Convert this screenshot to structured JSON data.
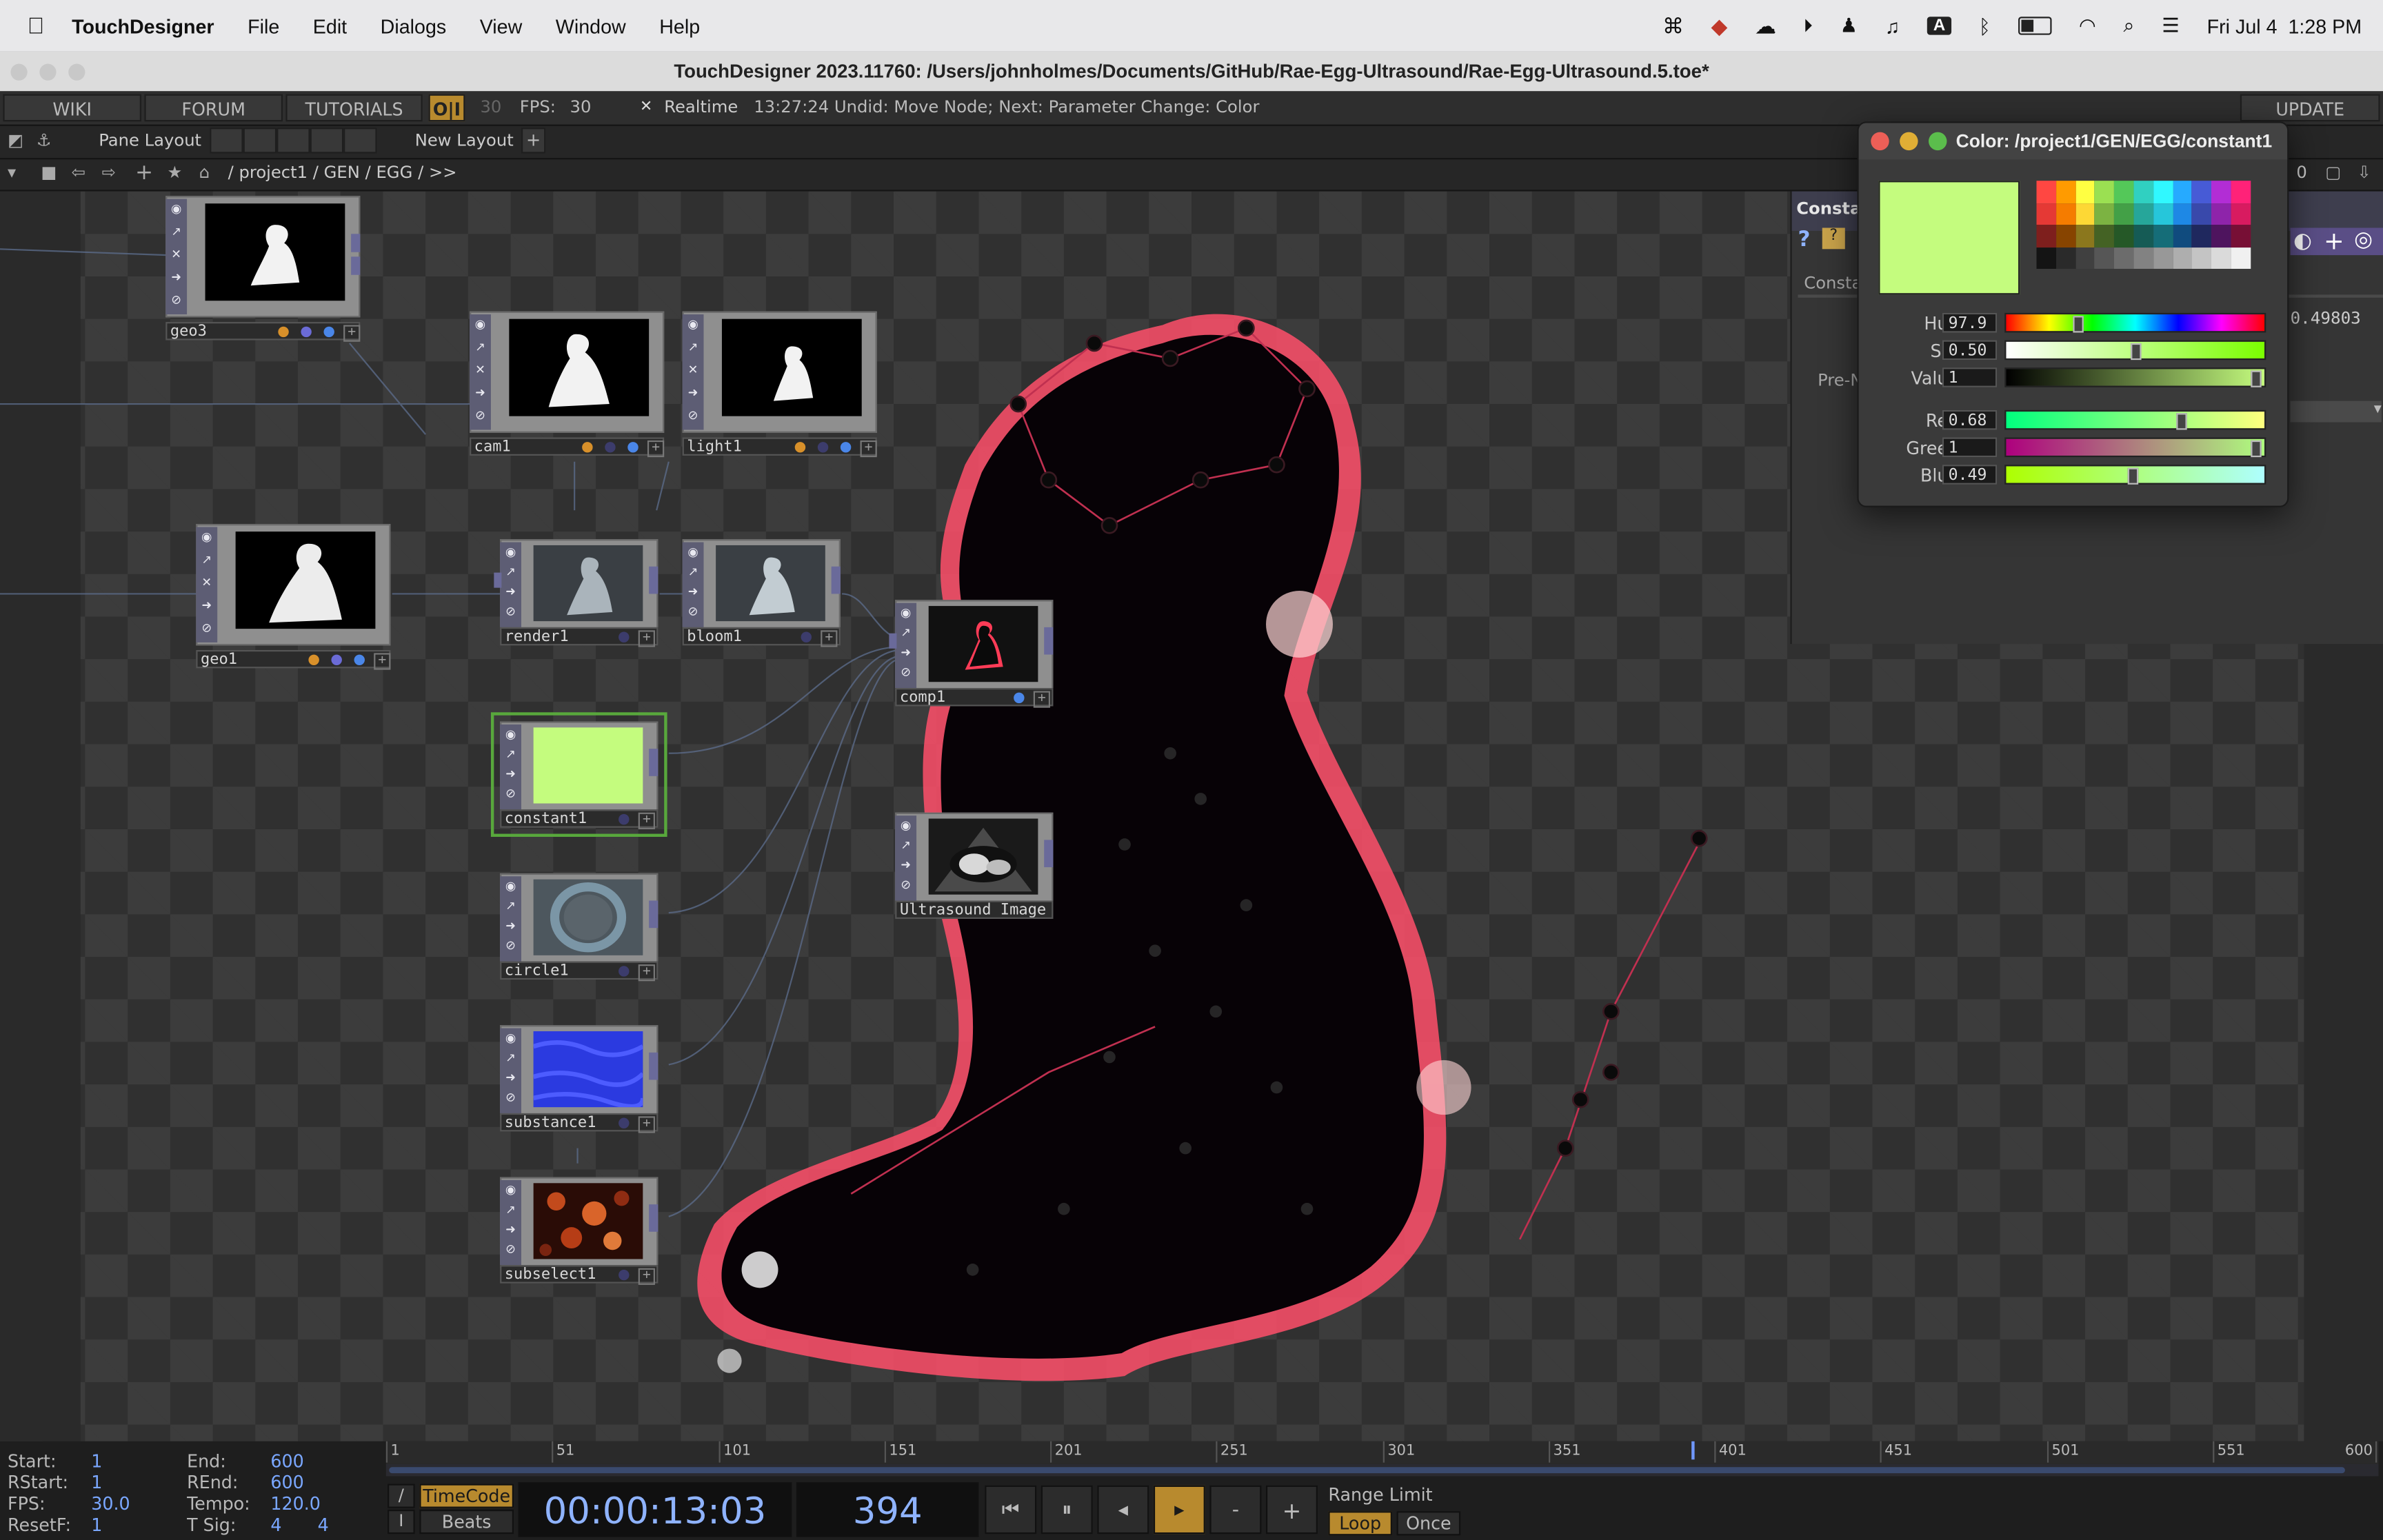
{
  "menubar": {
    "app": "TouchDesigner",
    "items": [
      "File",
      "Edit",
      "Dialogs",
      "View",
      "Window",
      "Help"
    ],
    "clock": "Fri Jul 4  1:28 PM",
    "status_icons": [
      "openai-icon",
      "dropbox-icon",
      "cloud-icon",
      "play-icon",
      "accessibility-icon",
      "headphones-icon",
      "input-a-icon",
      "bluetooth-icon",
      "battery-icon",
      "wifi-icon",
      "spotlight-icon",
      "control-center-icon"
    ],
    "input_letter": "A"
  },
  "window_title": "TouchDesigner 2023.11760: /Users/johnholmes/Documents/GitHub/Rae-Egg-Ultrasound/Rae-Egg-Ultrasound.5.toe*",
  "toolbar": {
    "wiki": "WIKI",
    "forum": "FORUM",
    "tutorials": "TUTORIALS",
    "oi": "O|I",
    "fps_target": "30",
    "fps_label": "FPS:",
    "fps_value": "30",
    "realtime_check": "✕",
    "realtime": "Realtime",
    "status": "13:27:24 Undid: Move Node; Next: Parameter Change: Color",
    "update": "UPDATE"
  },
  "pane_bar": {
    "pane_layout": "Pane Layout",
    "new_layout": "New Layout",
    "new_layout_plus": "+"
  },
  "path_bar": {
    "path": "/ project1 / GEN / EGG / >>",
    "zero": "0"
  },
  "nodes": [
    {
      "id": "geo3",
      "label": "geo3",
      "thumb": "white-figure",
      "dots": [
        "#d8902a",
        "#6b6bd6",
        "#4a86e8"
      ]
    },
    {
      "id": "cam1",
      "label": "cam1",
      "thumb": "white-figure",
      "dots": [
        "#d8902a",
        "#3c3c6c",
        "#4a86e8"
      ]
    },
    {
      "id": "light1",
      "label": "light1",
      "thumb": "white-figure",
      "dots": [
        "#d8902a",
        "#3c3c6c",
        "#4a86e8"
      ]
    },
    {
      "id": "geo1",
      "label": "geo1",
      "thumb": "white-figure",
      "dots": [
        "#d8902a",
        "#6b6bd6",
        "#4a86e8"
      ]
    },
    {
      "id": "render1",
      "label": "render1",
      "thumb": "grey-figure",
      "dots": []
    },
    {
      "id": "bloom1",
      "label": "bloom1",
      "thumb": "grey-figure",
      "dots": []
    },
    {
      "id": "comp1",
      "label": "comp1",
      "thumb": "red-figure",
      "dots": [
        "#4a86e8"
      ]
    },
    {
      "id": "constant1",
      "label": "constant1",
      "thumb": "solid",
      "color": "#c4fc7e",
      "dots": []
    },
    {
      "id": "ultrasound",
      "label": "Ultrasound_Image",
      "thumb": "ultrasound",
      "dots": []
    },
    {
      "id": "circle1",
      "label": "circle1",
      "thumb": "ring",
      "dots": []
    },
    {
      "id": "substance1",
      "label": "substance1",
      "thumb": "blue",
      "dots": []
    },
    {
      "id": "subselect1",
      "label": "subselect1",
      "thumb": "lava",
      "dots": []
    }
  ],
  "param_panel": {
    "title": "Constar",
    "tab": "Consta",
    "pre_label": "Pre-N",
    "value": "0.49803"
  },
  "color_dialog": {
    "title": "Color:  /project1/GEN/EGG/constant1",
    "swatch": "#c4fc7e",
    "hue": {
      "label": "Hue",
      "value": "97.9",
      "pos": 0.27
    },
    "sat": {
      "label": "Sat",
      "value": "0.50",
      "pos": 0.5
    },
    "val": {
      "label": "Value",
      "value": "1",
      "pos": 0.98
    },
    "red": {
      "label": "Red",
      "value": "0.68",
      "pos": 0.68
    },
    "green": {
      "label": "Green",
      "value": "1",
      "pos": 0.98
    },
    "blue": {
      "label": "Blue",
      "value": "0.49",
      "pos": 0.49
    }
  },
  "timeline": {
    "start_l": "Start:",
    "start_v": "1",
    "rstart_l": "RStart:",
    "rstart_v": "1",
    "fps_l": "FPS:",
    "fps_v": "30.0",
    "resetf_l": "ResetF:",
    "resetf_v": "1",
    "end_l": "End:",
    "end_v": "600",
    "rend_l": "REnd:",
    "rend_v": "600",
    "tempo_l": "Tempo:",
    "tempo_v": "120.0",
    "tsig_l": "T Sig:",
    "tsig_v1": "4",
    "tsig_v2": "4",
    "ticks": [
      "1",
      "51",
      "101",
      "151",
      "201",
      "251",
      "301",
      "351",
      "401",
      "451",
      "501",
      "551",
      "600"
    ],
    "timecode_btn": "TimeCode",
    "beats_btn": "Beats",
    "timecode": "00:00:13:03",
    "frame": "394",
    "frame_fraction": 0.655,
    "range_limit": "Range Limit",
    "loop": "Loop",
    "once": "Once",
    "slash1": "/",
    "slash2": "I",
    "minus": "-",
    "plus": "+"
  }
}
